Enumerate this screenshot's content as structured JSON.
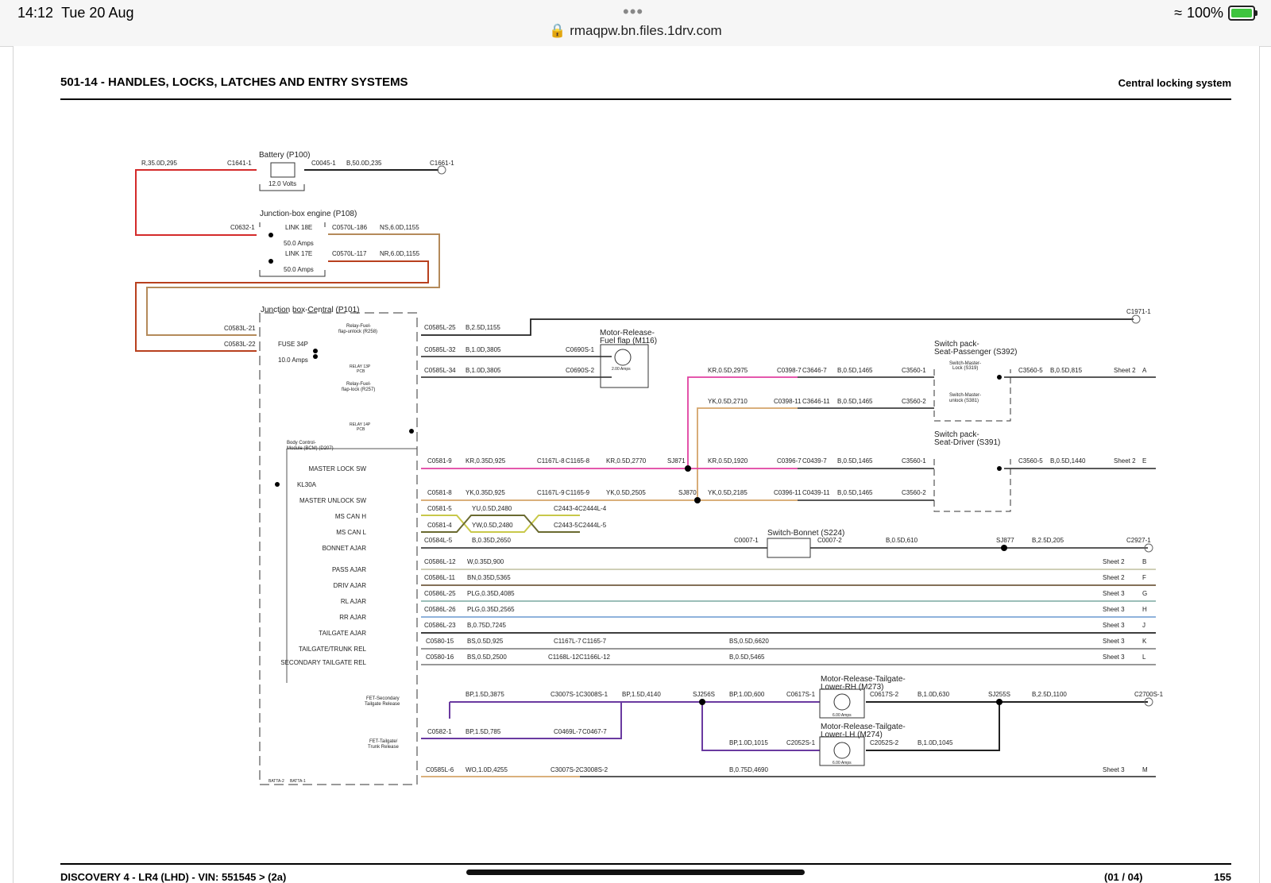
{
  "status_bar": {
    "time": "14:12",
    "date": "Tue 20 Aug",
    "dots": "•••",
    "url": "rmaqpw.bn.files.1drv.com",
    "battery": "100%"
  },
  "header": {
    "title": "501-14 - HANDLES, LOCKS, LATCHES AND ENTRY SYSTEMS",
    "subtitle": "Central locking system"
  },
  "footer": {
    "vehicle": "DISCOVERY 4 - LR4  (LHD) - VIN: 551545 >  (2a)",
    "sheet": "(01 / 04)",
    "page": "155"
  },
  "diagram": {
    "components": {
      "battery": "Battery (P100)",
      "battery_volts": "12.0 Volts",
      "jb_engine": "Junction-box engine (P108)",
      "link18": "LINK 18E",
      "link17": "LINK 17E",
      "amps50a": "50.0 Amps",
      "amps50b": "50.0 Amps",
      "jb_central": "Junction box-Central (P101)",
      "fuse34": "FUSE 34P",
      "fuse_amps": "10.0 Amps",
      "relay258a": "Relay-Fuel-",
      "relay258b": "flap-unlock (R258)",
      "relay13a": "RELAY 13P",
      "relay13b": "PCB",
      "relay257a": "Relay-Fuel-",
      "relay257b": "flap-lock (R257)",
      "relay14a": "RELAY 14P",
      "relay14b": "PCB",
      "bcm_a": "Body Control-",
      "bcm_b": "Module (BCM) (D207)",
      "motor_fuel_a": "Motor-Release-",
      "motor_fuel_b": "Fuel flap (M116)",
      "motor_fuel_amps": "2.00 Amps",
      "sp_pass_a": "Switch pack-",
      "sp_pass_b": "Seat-Passenger (S392)",
      "sp_drv_a": "Switch pack-",
      "sp_drv_b": "Seat-Driver (S391)",
      "sml_a": "Switch-Master-",
      "sml_b": "Lock (S319)",
      "smu_a": "Switch-Master-",
      "smu_b": "unlock (S381)",
      "bonnet": "Switch-Bonnet (S224)",
      "mrh_a": "Motor-Release-Tailgate-",
      "mrh_b": "Lower-RH (M273)",
      "mlh_a": "Motor-Release-Tailgate-",
      "mlh_b": "Lower-LH (M274)",
      "motor_amps": "6.00 Amps",
      "fet_sec_a": "FET-Secondary",
      "fet_sec_b": "Tailgate Release",
      "fet_tg_a": "FET-Tailgate/",
      "fet_tg_b": "Trunk Release",
      "batta2": "BATTA-2",
      "batta1": "BATTA-1"
    },
    "bcm_pins": [
      "MASTER LOCK SW",
      "KL30A",
      "MASTER UNLOCK SW",
      "MS CAN H",
      "MS CAN L",
      "BONNET AJAR",
      "PASS AJAR",
      "DRIV AJAR",
      "RL AJAR",
      "RR AJAR",
      "TAILGATE AJAR",
      "TAILGATE/TRUNK REL",
      "SECONDARY TAILGATE REL"
    ],
    "labels": [
      "R,35.0D,295",
      "C1641-1",
      "C0045-1",
      "B,50.0D,235",
      "C1661-1",
      "C0632-1",
      "C0570L-186",
      "NS,6.0D,1155",
      "C0570L-117",
      "NR,6.0D,1155",
      "C0583L-21",
      "C0583L-22",
      "C1971-1",
      "C0585L-25",
      "B,2.5D,1155",
      "C0585L-32",
      "B,1.0D,3805",
      "C0690S-1",
      "C0585L-34",
      "B,1.0D,3805",
      "C0690S-2",
      "KR,0.5D,2975",
      "C0398-7",
      "C3646-7",
      "B,0.5D,1465",
      "C3560-1",
      "C3560-5",
      "B,0.5D,815",
      "Sheet 2",
      "A",
      "YK,0.5D,2710",
      "C0398-11",
      "C3646-11",
      "B,0.5D,1465",
      "C3560-2",
      "C0581-9",
      "KR,0.35D,925",
      "C1167L-8",
      "C1165-8",
      "KR,0.5D,2770",
      "SJ871",
      "KR,0.5D,1920",
      "C0396-7",
      "C0439-7",
      "B,0.5D,1465",
      "C3560-1",
      "C3560-5",
      "B,0.5D,1440",
      "Sheet 2",
      "E",
      "C0581-8",
      "YK,0.35D,925",
      "C1167L-9",
      "C1165-9",
      "YK,0.5D,2505",
      "SJ870",
      "YK,0.5D,2185",
      "C0396-11",
      "C0439-11",
      "B,0.5D,1465",
      "C3560-2",
      "C0581-5",
      "YU,0.5D,2480",
      "C2443-4",
      "C2444L-4",
      "C0581-4",
      "YW,0.5D,2480",
      "C2443-5",
      "C2444L-5",
      "C0584L-5",
      "B,0.35D,2650",
      "C0007-1",
      "C0007-2",
      "B,0.5D,610",
      "SJ877",
      "B,2.5D,205",
      "C2927-1",
      "C0586L-12",
      "W,0.35D,900",
      "Sheet 2",
      "B",
      "C0586L-11",
      "BN,0.35D,5365",
      "Sheet 2",
      "F",
      "C0586L-25",
      "PLG,0.35D,4085",
      "Sheet 3",
      "G",
      "C0586L-26",
      "PLG,0.35D,2565",
      "Sheet 3",
      "H",
      "C0586L-23",
      "B,0.75D,7245",
      "Sheet 3",
      "J",
      "C0580-15",
      "BS,0.5D,925",
      "C1167L-7",
      "C1165-7",
      "BS,0.5D,6620",
      "Sheet 3",
      "K",
      "C0580-16",
      "BS,0.5D,2500",
      "C1168L-12",
      "C1166L-12",
      "B,0.5D,5465",
      "Sheet 3",
      "L",
      "BP,1.5D,3875",
      "C3007S-1",
      "C3008S-1",
      "BP,1.5D,4140",
      "SJ256S",
      "BP,1.0D,600",
      "C0617S-1",
      "C0617S-2",
      "B,1.0D,630",
      "SJ255S",
      "B,2.5D,1100",
      "C2700S-1",
      "C0582-1",
      "BP,1.5D,785",
      "C0469L-7",
      "C0467-7",
      "BP,1.0D,1015",
      "C2052S-1",
      "C2052S-2",
      "B,1.0D,1045",
      "C0585L-6",
      "WO,1.0D,4255",
      "C3007S-2",
      "C3008S-2",
      "B,0.75D,4690",
      "Sheet 3",
      "M"
    ]
  },
  "colors": {
    "red": "#d42a2a",
    "brown": "#b48a5a",
    "darkred": "#b8401e",
    "magenta": "#e040a0",
    "tan": "#d4a46a",
    "yellowgreen": "#c8c84a",
    "olive": "#6a6a30",
    "purple": "#6a3aa0",
    "blue": "#6a9ad0",
    "gray": "#9a9a9a",
    "dark_brown": "#5a4020"
  }
}
